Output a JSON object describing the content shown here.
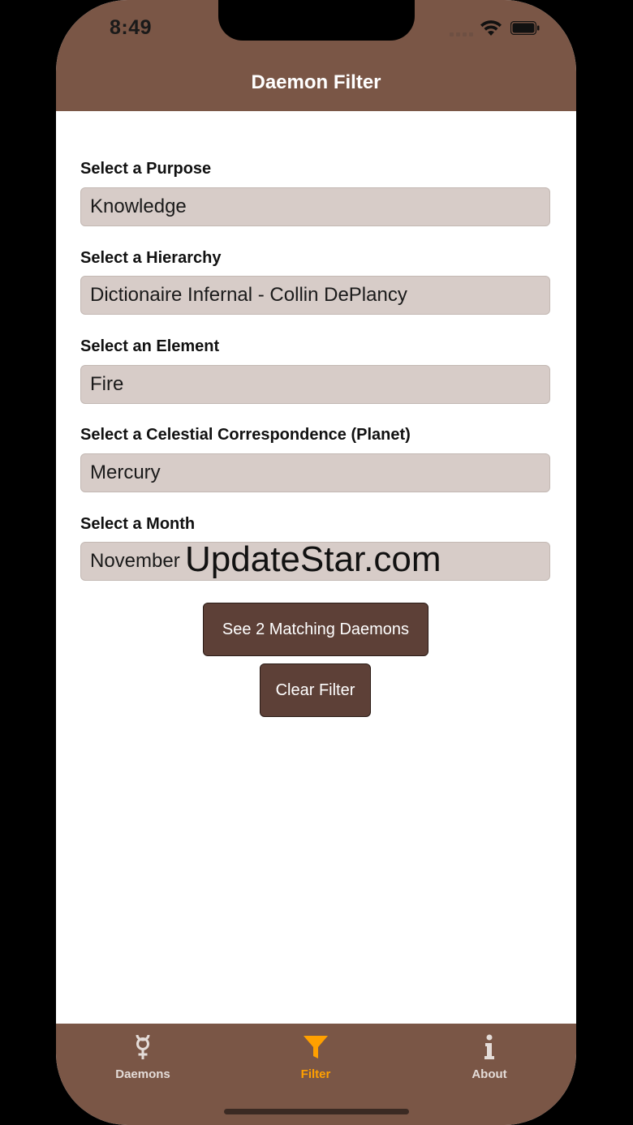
{
  "status_bar": {
    "time": "8:49"
  },
  "nav": {
    "title": "Daemon Filter"
  },
  "filters": [
    {
      "label": "Select a Purpose",
      "value": "Knowledge"
    },
    {
      "label": "Select a Hierarchy",
      "value": "Dictionaire Infernal - Collin DePlancy"
    },
    {
      "label": "Select an Element",
      "value": "Fire"
    },
    {
      "label": "Select a Celestial Correspondence (Planet)",
      "value": "Mercury"
    },
    {
      "label": "Select a Month",
      "value": "November"
    }
  ],
  "watermark": "UpdateStar.com",
  "buttons": {
    "see_matching": "See 2 Matching Daemons",
    "clear_filter": "Clear Filter"
  },
  "tabs": [
    {
      "label": "Daemons",
      "icon": "mercury-symbol-icon",
      "active": false
    },
    {
      "label": "Filter",
      "icon": "funnel-icon",
      "active": true
    },
    {
      "label": "About",
      "icon": "info-icon",
      "active": false
    }
  ],
  "colors": {
    "bar": "#7a5646",
    "field": "#d7ccc8",
    "button": "#5d4037",
    "active_tab": "#ffa000"
  }
}
